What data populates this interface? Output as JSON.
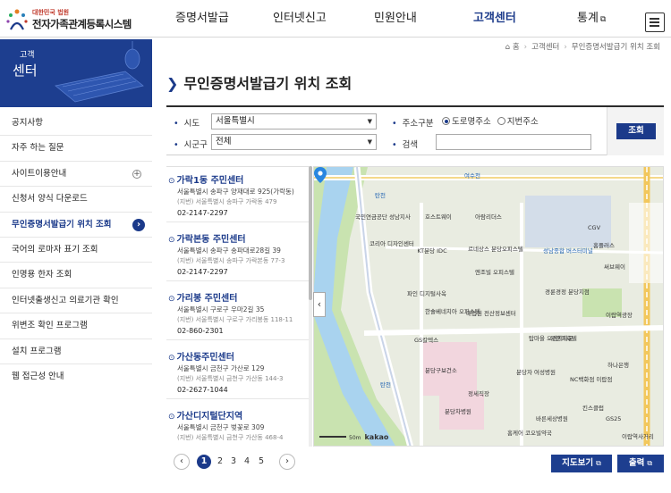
{
  "header": {
    "logo_sub": "대한민국 법원",
    "logo_title": "전자가족관계등록시스템",
    "gnb": [
      {
        "label": "증명서발급"
      },
      {
        "label": "인터넷신고"
      },
      {
        "label": "민원안내"
      },
      {
        "label": "고객센터"
      },
      {
        "label": "통계"
      }
    ]
  },
  "breadcrumb": [
    "홈",
    "고객센터",
    "무인증명서발급기 위치 조회"
  ],
  "side_banner": {
    "line1": "고객",
    "line2": "센터"
  },
  "sidebar": {
    "items": [
      {
        "label": "공지사항"
      },
      {
        "label": "자주 하는 질문"
      },
      {
        "label": "사이트이용안내"
      },
      {
        "label": "신청서 양식 다운로드"
      },
      {
        "label": "무인증명서발급기 위치 조회"
      },
      {
        "label": "국어의 로마자 표기 조회"
      },
      {
        "label": "인명용 한자 조회"
      },
      {
        "label": "인터넷출생신고 의료기관 확인"
      },
      {
        "label": "위변조 확인 프로그램"
      },
      {
        "label": "설치 프로그램"
      },
      {
        "label": "웹 접근성 안내"
      }
    ]
  },
  "page_title": "무인증명서발급기 위치 조회",
  "search": {
    "sido_label": "시도",
    "sido_value": "서울특별시",
    "sigungu_label": "시군구",
    "sigungu_value": "전체",
    "addr_type_label": "주소구분",
    "addr_type_road": "도로명주소",
    "addr_type_jibun": "지번주소",
    "keyword_label": "검색",
    "keyword_value": "",
    "submit_label": "조회"
  },
  "results": [
    {
      "name": "가락1동 주민센터",
      "addr": "서울특별시 송파구 양재대로 925(가락동)",
      "jibun": "(지번) 서울특별시 송파구 가락동 479",
      "tel": "02-2147-2297"
    },
    {
      "name": "가락본동 주민센터",
      "addr": "서울특별시 송파구 송파대로28길 39",
      "jibun": "(지번) 서울특별시 송파구 가락본동 77-3",
      "tel": "02-2147-2297"
    },
    {
      "name": "가리봉 주민센터",
      "addr": "서울특별시 구로구 우마2길 35",
      "jibun": "(지번) 서울특별시 구로구 가리봉동 118-11",
      "tel": "02-860-2301"
    },
    {
      "name": "가산동주민센터",
      "addr": "서울특별시 금천구 가산로 129",
      "jibun": "(지번) 서울특별시 금천구 가산동 144-3",
      "tel": "02-2627-1044"
    },
    {
      "name": "가산디지털단지역",
      "addr": "서울특별시 금천구 벚꽃로 309",
      "jibun": "(지번) 서울특별시 금천구 가산동 468-4",
      "tel": ""
    }
  ],
  "map": {
    "labels": [
      "여수천",
      "탄천",
      "국민연금공단 성남지사",
      "호스트웨이",
      "아람리더스",
      "CGV",
      "홈플러스",
      "코리아 디자인센터",
      "KT분당 IDC",
      "르네상스 분당오피스텔",
      "성남종합 버스터미널",
      "써브웨이",
      "엔조빌 오피스텔",
      "파인 디지털사옥",
      "한솔베네치아 오피스텔",
      "대법원 전산정보센터",
      "경륜경정 분당지점",
      "이랍역광장",
      "GS칼텍스",
      "탑마을 오렌지타운",
      "유앤미호텔",
      "분당구보건소",
      "분당자 여성병원",
      "정세직장",
      "분당차병원",
      "NC백화점 이랍점",
      "하나은행",
      "킨스클럽",
      "GS25",
      "바른세상병원",
      "홈케어 코오빌약국",
      "이랍역사거리",
      "탄천",
      "50m",
      "kakao"
    ]
  },
  "pagination": {
    "prev": "‹",
    "next": "›",
    "pages": [
      "1",
      "2",
      "3",
      "4",
      "5"
    ],
    "current": "1"
  },
  "buttons": {
    "map_view": "지도보기",
    "print": "출력"
  },
  "colors": {
    "primary": "#1d3e8f",
    "accent": "#1b3a8a"
  },
  "icons": [
    "home-icon",
    "menu-icon",
    "external-link-icon",
    "location-pin-icon",
    "chevron-left-icon",
    "chevron-right-icon",
    "plus-circle-icon",
    "arrow-circle-right-icon"
  ]
}
